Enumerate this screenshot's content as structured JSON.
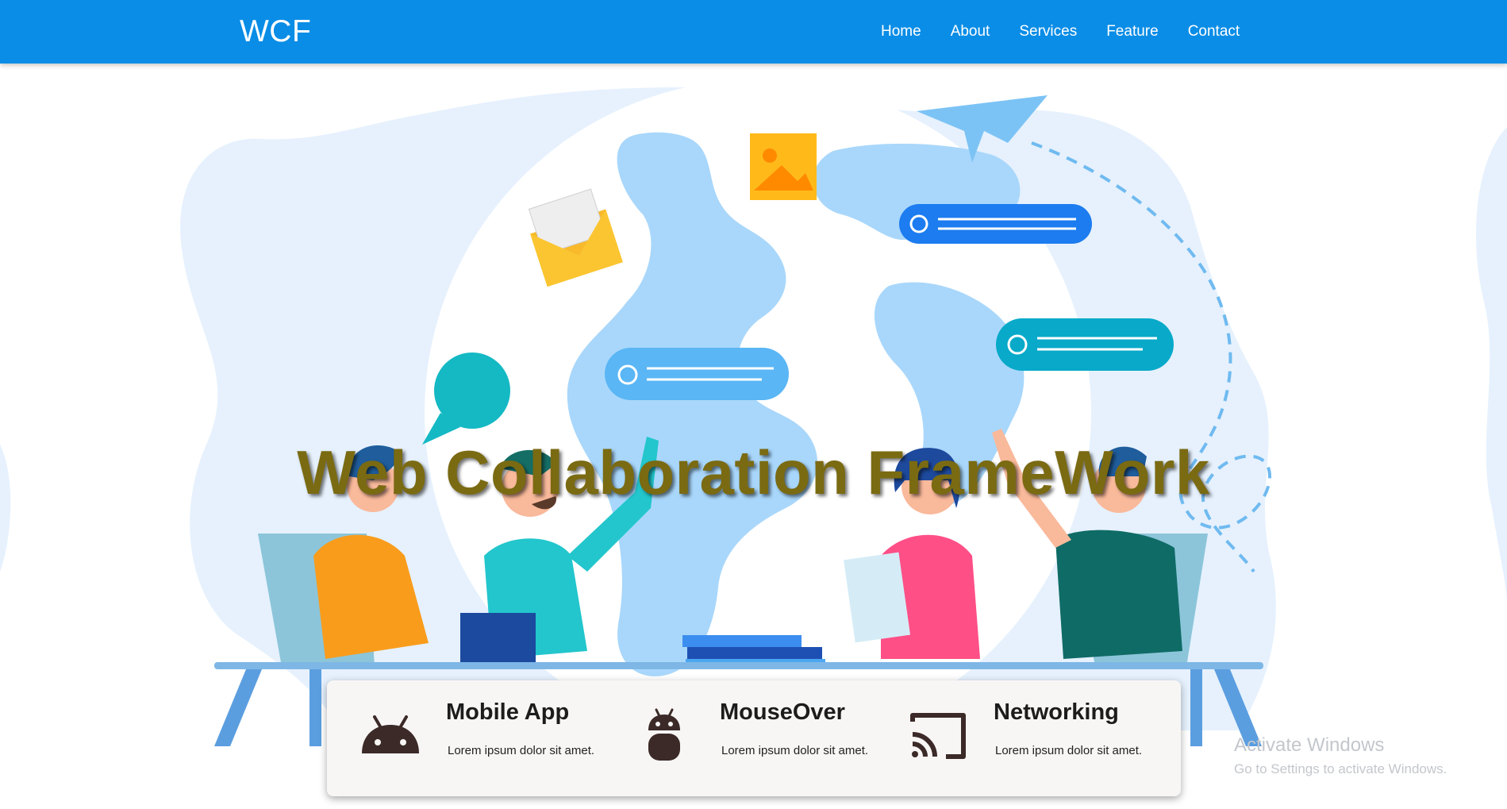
{
  "navbar": {
    "brand": "WCF",
    "links": [
      "Home",
      "About",
      "Services",
      "Feature",
      "Contact"
    ]
  },
  "hero": {
    "title": "Web Collaboration FrameWork"
  },
  "features": [
    {
      "icon": "android-head-icon",
      "title": "Mobile App",
      "description": "Lorem ipsum dolor sit amet."
    },
    {
      "icon": "android-robot-icon",
      "title": "MouseOver",
      "description": "Lorem ipsum dolor sit amet."
    },
    {
      "icon": "cast-icon",
      "title": "Networking",
      "description": "Lorem ipsum dolor sit amet."
    }
  ],
  "watermark": {
    "line1": "Activate Windows",
    "line2": "Go to Settings to activate Windows."
  },
  "colors": {
    "navbar": "#0a8de6",
    "title": "#7a6a12",
    "card": "#f8f6f5",
    "icon": "#3b2a27"
  }
}
